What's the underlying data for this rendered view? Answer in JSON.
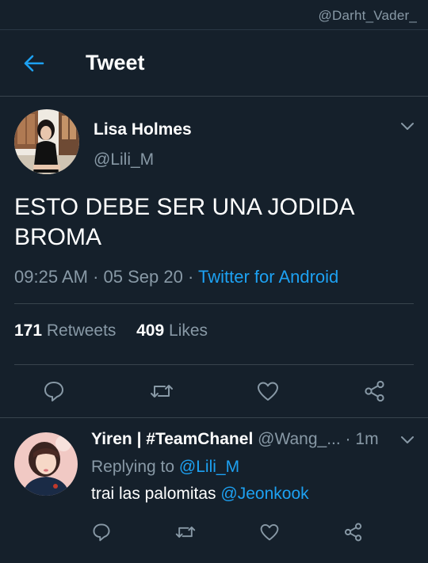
{
  "watermark": "@Darht_Vader_",
  "header": {
    "title": "Tweet",
    "back_icon": "arrow-left-icon",
    "accent": "#1da1f2"
  },
  "main_tweet": {
    "author_name": "Lisa Holmes",
    "author_handle": "@Lili_M",
    "text_line1": "ESTO DEBE SER UNA JODIDA",
    "text_line2": "BROMA",
    "time": "09:25 AM",
    "separator": " · ",
    "date": "05 Sep 20",
    "separator2": " · ",
    "source": "Twitter for Android",
    "retweets_count": "171",
    "retweets_label": "Retweets",
    "likes_count": "409",
    "likes_label": "Likes"
  },
  "reply": {
    "author_name": "Yiren | #TeamChanel",
    "author_handle": "@Wang_...",
    "dot": " · ",
    "time": "1m",
    "replying_label": "Replying to",
    "replying_to": "@Lili_M",
    "text": "trai las palomitas",
    "mention": "@Jeonkook"
  },
  "colors": {
    "background": "#15202b",
    "secondary_text": "#8899a6",
    "divider": "#38444d",
    "link": "#1da1f2"
  }
}
